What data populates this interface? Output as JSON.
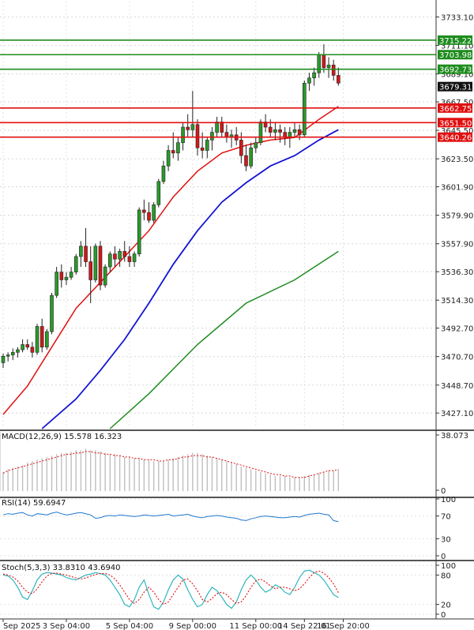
{
  "chart_data": [
    {
      "type": "candlestick",
      "panel": "price",
      "ylim": [
        3415,
        3745
      ],
      "yticks": [
        "3733.10",
        "3711.10",
        "3689.10",
        "3667.50",
        "3645.50",
        "3623.50",
        "3601.90",
        "3579.90",
        "3557.90",
        "3536.30",
        "3514.30",
        "3492.70",
        "3470.70",
        "3448.70",
        "3427.10"
      ],
      "ytick_values": [
        3733.1,
        3711.1,
        3689.1,
        3667.5,
        3645.5,
        3623.5,
        3601.9,
        3579.9,
        3557.9,
        3536.3,
        3514.3,
        3492.7,
        3470.7,
        3448.7,
        3427.1
      ],
      "current_price": {
        "label": "3679.31",
        "value": 3679.31
      },
      "resistance_levels": [
        {
          "label": "3715.22",
          "value": 3715.22,
          "color": "#1e8c1e"
        },
        {
          "label": "3703.98",
          "value": 3703.98,
          "color": "#1e8c1e"
        },
        {
          "label": "3692.73",
          "value": 3692.73,
          "color": "#1e8c1e"
        }
      ],
      "support_levels": [
        {
          "label": "3662.75",
          "value": 3662.75,
          "color": "#e01010"
        },
        {
          "label": "3651.50",
          "value": 3651.5,
          "color": "#e01010"
        },
        {
          "label": "3640.26",
          "value": 3640.26,
          "color": "#e01010"
        }
      ],
      "candles": [
        [
          3466,
          3473,
          3462,
          3471
        ],
        [
          3471,
          3474,
          3467,
          3472
        ],
        [
          3472,
          3477,
          3468,
          3474
        ],
        [
          3474,
          3478,
          3470,
          3476
        ],
        [
          3476,
          3484,
          3474,
          3480
        ],
        [
          3480,
          3484,
          3476,
          3478
        ],
        [
          3478,
          3482,
          3470,
          3474
        ],
        [
          3474,
          3496,
          3472,
          3494
        ],
        [
          3494,
          3500,
          3474,
          3478
        ],
        [
          3478,
          3492,
          3476,
          3490
        ],
        [
          3490,
          3520,
          3488,
          3518
        ],
        [
          3518,
          3540,
          3516,
          3536
        ],
        [
          3536,
          3542,
          3524,
          3530
        ],
        [
          3530,
          3536,
          3526,
          3532
        ],
        [
          3532,
          3540,
          3530,
          3536
        ],
        [
          3536,
          3550,
          3534,
          3548
        ],
        [
          3548,
          3560,
          3540,
          3556
        ],
        [
          3556,
          3570,
          3540,
          3544
        ],
        [
          3544,
          3556,
          3512,
          3530
        ],
        [
          3530,
          3558,
          3528,
          3556
        ],
        [
          3556,
          3560,
          3522,
          3526
        ],
        [
          3526,
          3542,
          3524,
          3540
        ],
        [
          3540,
          3552,
          3536,
          3550
        ],
        [
          3550,
          3556,
          3540,
          3546
        ],
        [
          3546,
          3554,
          3540,
          3552
        ],
        [
          3552,
          3560,
          3544,
          3548
        ],
        [
          3548,
          3556,
          3540,
          3544
        ],
        [
          3544,
          3552,
          3540,
          3550
        ],
        [
          3550,
          3586,
          3548,
          3584
        ],
        [
          3584,
          3592,
          3576,
          3582
        ],
        [
          3582,
          3590,
          3574,
          3576
        ],
        [
          3576,
          3590,
          3574,
          3588
        ],
        [
          3588,
          3608,
          3586,
          3606
        ],
        [
          3606,
          3622,
          3604,
          3618
        ],
        [
          3618,
          3634,
          3614,
          3630
        ],
        [
          3630,
          3644,
          3624,
          3628
        ],
        [
          3628,
          3640,
          3622,
          3636
        ],
        [
          3636,
          3652,
          3630,
          3648
        ],
        [
          3648,
          3658,
          3640,
          3646
        ],
        [
          3646,
          3676,
          3640,
          3650
        ],
        [
          3650,
          3654,
          3626,
          3632
        ],
        [
          3632,
          3644,
          3624,
          3630
        ],
        [
          3630,
          3640,
          3624,
          3638
        ],
        [
          3638,
          3648,
          3630,
          3644
        ],
        [
          3644,
          3656,
          3640,
          3652
        ],
        [
          3652,
          3656,
          3640,
          3644
        ],
        [
          3644,
          3650,
          3636,
          3640
        ],
        [
          3640,
          3646,
          3632,
          3642
        ],
        [
          3642,
          3648,
          3634,
          3638
        ],
        [
          3638,
          3644,
          3620,
          3626
        ],
        [
          3626,
          3634,
          3614,
          3618
        ],
        [
          3618,
          3636,
          3616,
          3632
        ],
        [
          3632,
          3640,
          3628,
          3636
        ],
        [
          3636,
          3654,
          3634,
          3652
        ],
        [
          3652,
          3658,
          3644,
          3648
        ],
        [
          3648,
          3654,
          3640,
          3644
        ],
        [
          3644,
          3652,
          3638,
          3646
        ],
        [
          3646,
          3650,
          3636,
          3644
        ],
        [
          3644,
          3648,
          3634,
          3640
        ],
        [
          3640,
          3648,
          3632,
          3644
        ],
        [
          3644,
          3652,
          3640,
          3646
        ],
        [
          3646,
          3650,
          3638,
          3642
        ],
        [
          3642,
          3684,
          3640,
          3682
        ],
        [
          3682,
          3690,
          3676,
          3686
        ],
        [
          3686,
          3694,
          3680,
          3690
        ],
        [
          3690,
          3706,
          3686,
          3704
        ],
        [
          3704,
          3712,
          3690,
          3694
        ],
        [
          3694,
          3702,
          3686,
          3696
        ],
        [
          3696,
          3700,
          3684,
          3688
        ],
        [
          3688,
          3694,
          3680,
          3682
        ]
      ],
      "ma_fast": {
        "color": "#e01010",
        "x": [
          0,
          5,
          10,
          15,
          20,
          25,
          30,
          35,
          40,
          45,
          50,
          55,
          60,
          65,
          69
        ],
        "y": [
          3426,
          3448,
          3478,
          3508,
          3528,
          3548,
          3568,
          3594,
          3614,
          3628,
          3634,
          3638,
          3640,
          3654,
          3664
        ]
      },
      "ma_mid": {
        "color": "#1414d4",
        "x": [
          8,
          15,
          20,
          25,
          30,
          35,
          40,
          45,
          50,
          55,
          60,
          65,
          69
        ],
        "y": [
          3415,
          3438,
          3460,
          3484,
          3512,
          3542,
          3568,
          3590,
          3605,
          3618,
          3626,
          3638,
          3646
        ]
      },
      "ma_slow": {
        "color": "#1e8c1e",
        "x": [
          22,
          30,
          40,
          50,
          60,
          69
        ],
        "y": [
          3415,
          3442,
          3480,
          3512,
          3530,
          3552
        ]
      }
    },
    {
      "type": "bar",
      "panel": "macd",
      "title": "MACD(12,26,9) 15.578 16.323",
      "yticks": [
        "38.073",
        "0"
      ],
      "ylim": [
        0,
        40
      ],
      "hist": [
        14,
        16,
        17,
        18,
        19,
        21,
        22,
        23,
        24,
        25,
        26,
        27,
        28,
        28,
        29,
        30,
        30,
        31,
        30,
        30,
        29,
        28,
        27,
        27,
        26,
        25,
        25,
        24,
        24,
        23,
        23,
        22,
        22,
        22,
        23,
        24,
        25,
        26,
        27,
        28,
        28,
        27,
        26,
        25,
        24,
        23,
        22,
        21,
        20,
        18,
        17,
        16,
        15,
        14,
        13,
        12,
        11,
        11,
        11,
        10,
        10,
        10,
        11,
        12,
        12,
        13,
        14,
        15,
        15,
        16
      ],
      "signal": {
        "color": "#e01010",
        "values": [
          13,
          15,
          16,
          17,
          18,
          19,
          20,
          21,
          22,
          23,
          24,
          25,
          26,
          27,
          27,
          28,
          28,
          29,
          29,
          28,
          28,
          27,
          27,
          26,
          26,
          25,
          25,
          24,
          24,
          23,
          23,
          23,
          22,
          22,
          23,
          23,
          24,
          25,
          25,
          26,
          26,
          26,
          25,
          25,
          24,
          23,
          22,
          21,
          20,
          19,
          18,
          17,
          16,
          15,
          14,
          13,
          12,
          12,
          11,
          11,
          10,
          10,
          10,
          11,
          12,
          13,
          14,
          15,
          15,
          16
        ]
      }
    },
    {
      "type": "line",
      "panel": "rsi",
      "title": "RSI(14) 59.6947",
      "yticks": [
        "100",
        "70",
        "30",
        "0"
      ],
      "ylim": [
        0,
        100
      ],
      "series": [
        {
          "color": "#1e78d0",
          "values": [
            72,
            74,
            73,
            75,
            76,
            72,
            70,
            74,
            73,
            72,
            75,
            77,
            74,
            72,
            73,
            75,
            76,
            74,
            72,
            66,
            67,
            70,
            71,
            70,
            72,
            71,
            70,
            69,
            70,
            72,
            71,
            70,
            71,
            72,
            73,
            70,
            71,
            72,
            73,
            70,
            68,
            67,
            69,
            70,
            71,
            70,
            68,
            67,
            66,
            63,
            62,
            65,
            67,
            69,
            70,
            69,
            68,
            67,
            67,
            68,
            69,
            68,
            71,
            73,
            74,
            75,
            73,
            72,
            62,
            60
          ]
        }
      ]
    },
    {
      "type": "line",
      "panel": "stoch",
      "title": "Stoch(5,3,3) 33.8310 43.6940",
      "yticks": [
        "100",
        "80",
        "20",
        "0"
      ],
      "ylim": [
        0,
        100
      ],
      "series": [
        {
          "color": "#20b0b8",
          "values": [
            80,
            78,
            70,
            55,
            35,
            30,
            48,
            70,
            82,
            85,
            84,
            82,
            80,
            75,
            72,
            70,
            75,
            80,
            82,
            85,
            83,
            80,
            70,
            55,
            40,
            20,
            15,
            30,
            55,
            70,
            40,
            15,
            10,
            25,
            50,
            70,
            80,
            72,
            50,
            30,
            15,
            20,
            40,
            55,
            48,
            35,
            20,
            12,
            25,
            50,
            70,
            80,
            70,
            55,
            45,
            50,
            60,
            55,
            45,
            40,
            55,
            75,
            88,
            90,
            85,
            80,
            70,
            55,
            40,
            34
          ]
        },
        {
          "color": "#e01010",
          "values": [
            82,
            80,
            76,
            68,
            55,
            45,
            42,
            52,
            66,
            78,
            83,
            84,
            82,
            80,
            77,
            74,
            72,
            74,
            78,
            81,
            83,
            83,
            80,
            72,
            60,
            45,
            30,
            22,
            30,
            45,
            55,
            45,
            30,
            20,
            25,
            40,
            55,
            70,
            72,
            62,
            48,
            30,
            25,
            32,
            42,
            45,
            40,
            30,
            22,
            25,
            38,
            55,
            68,
            72,
            66,
            58,
            52,
            55,
            55,
            52,
            48,
            52,
            62,
            75,
            85,
            88,
            84,
            75,
            62,
            44
          ]
        }
      ]
    }
  ],
  "xaxis": {
    "labels": [
      "Sep 2025",
      "3 Sep 04:00",
      "5 Sep 04:00",
      "9 Sep 00:00",
      "11 Sep 00:00",
      "14 Sep 22:01",
      "16 Sep 20:00"
    ],
    "label_positions": [
      0,
      13,
      26,
      39,
      52,
      62,
      70
    ]
  }
}
